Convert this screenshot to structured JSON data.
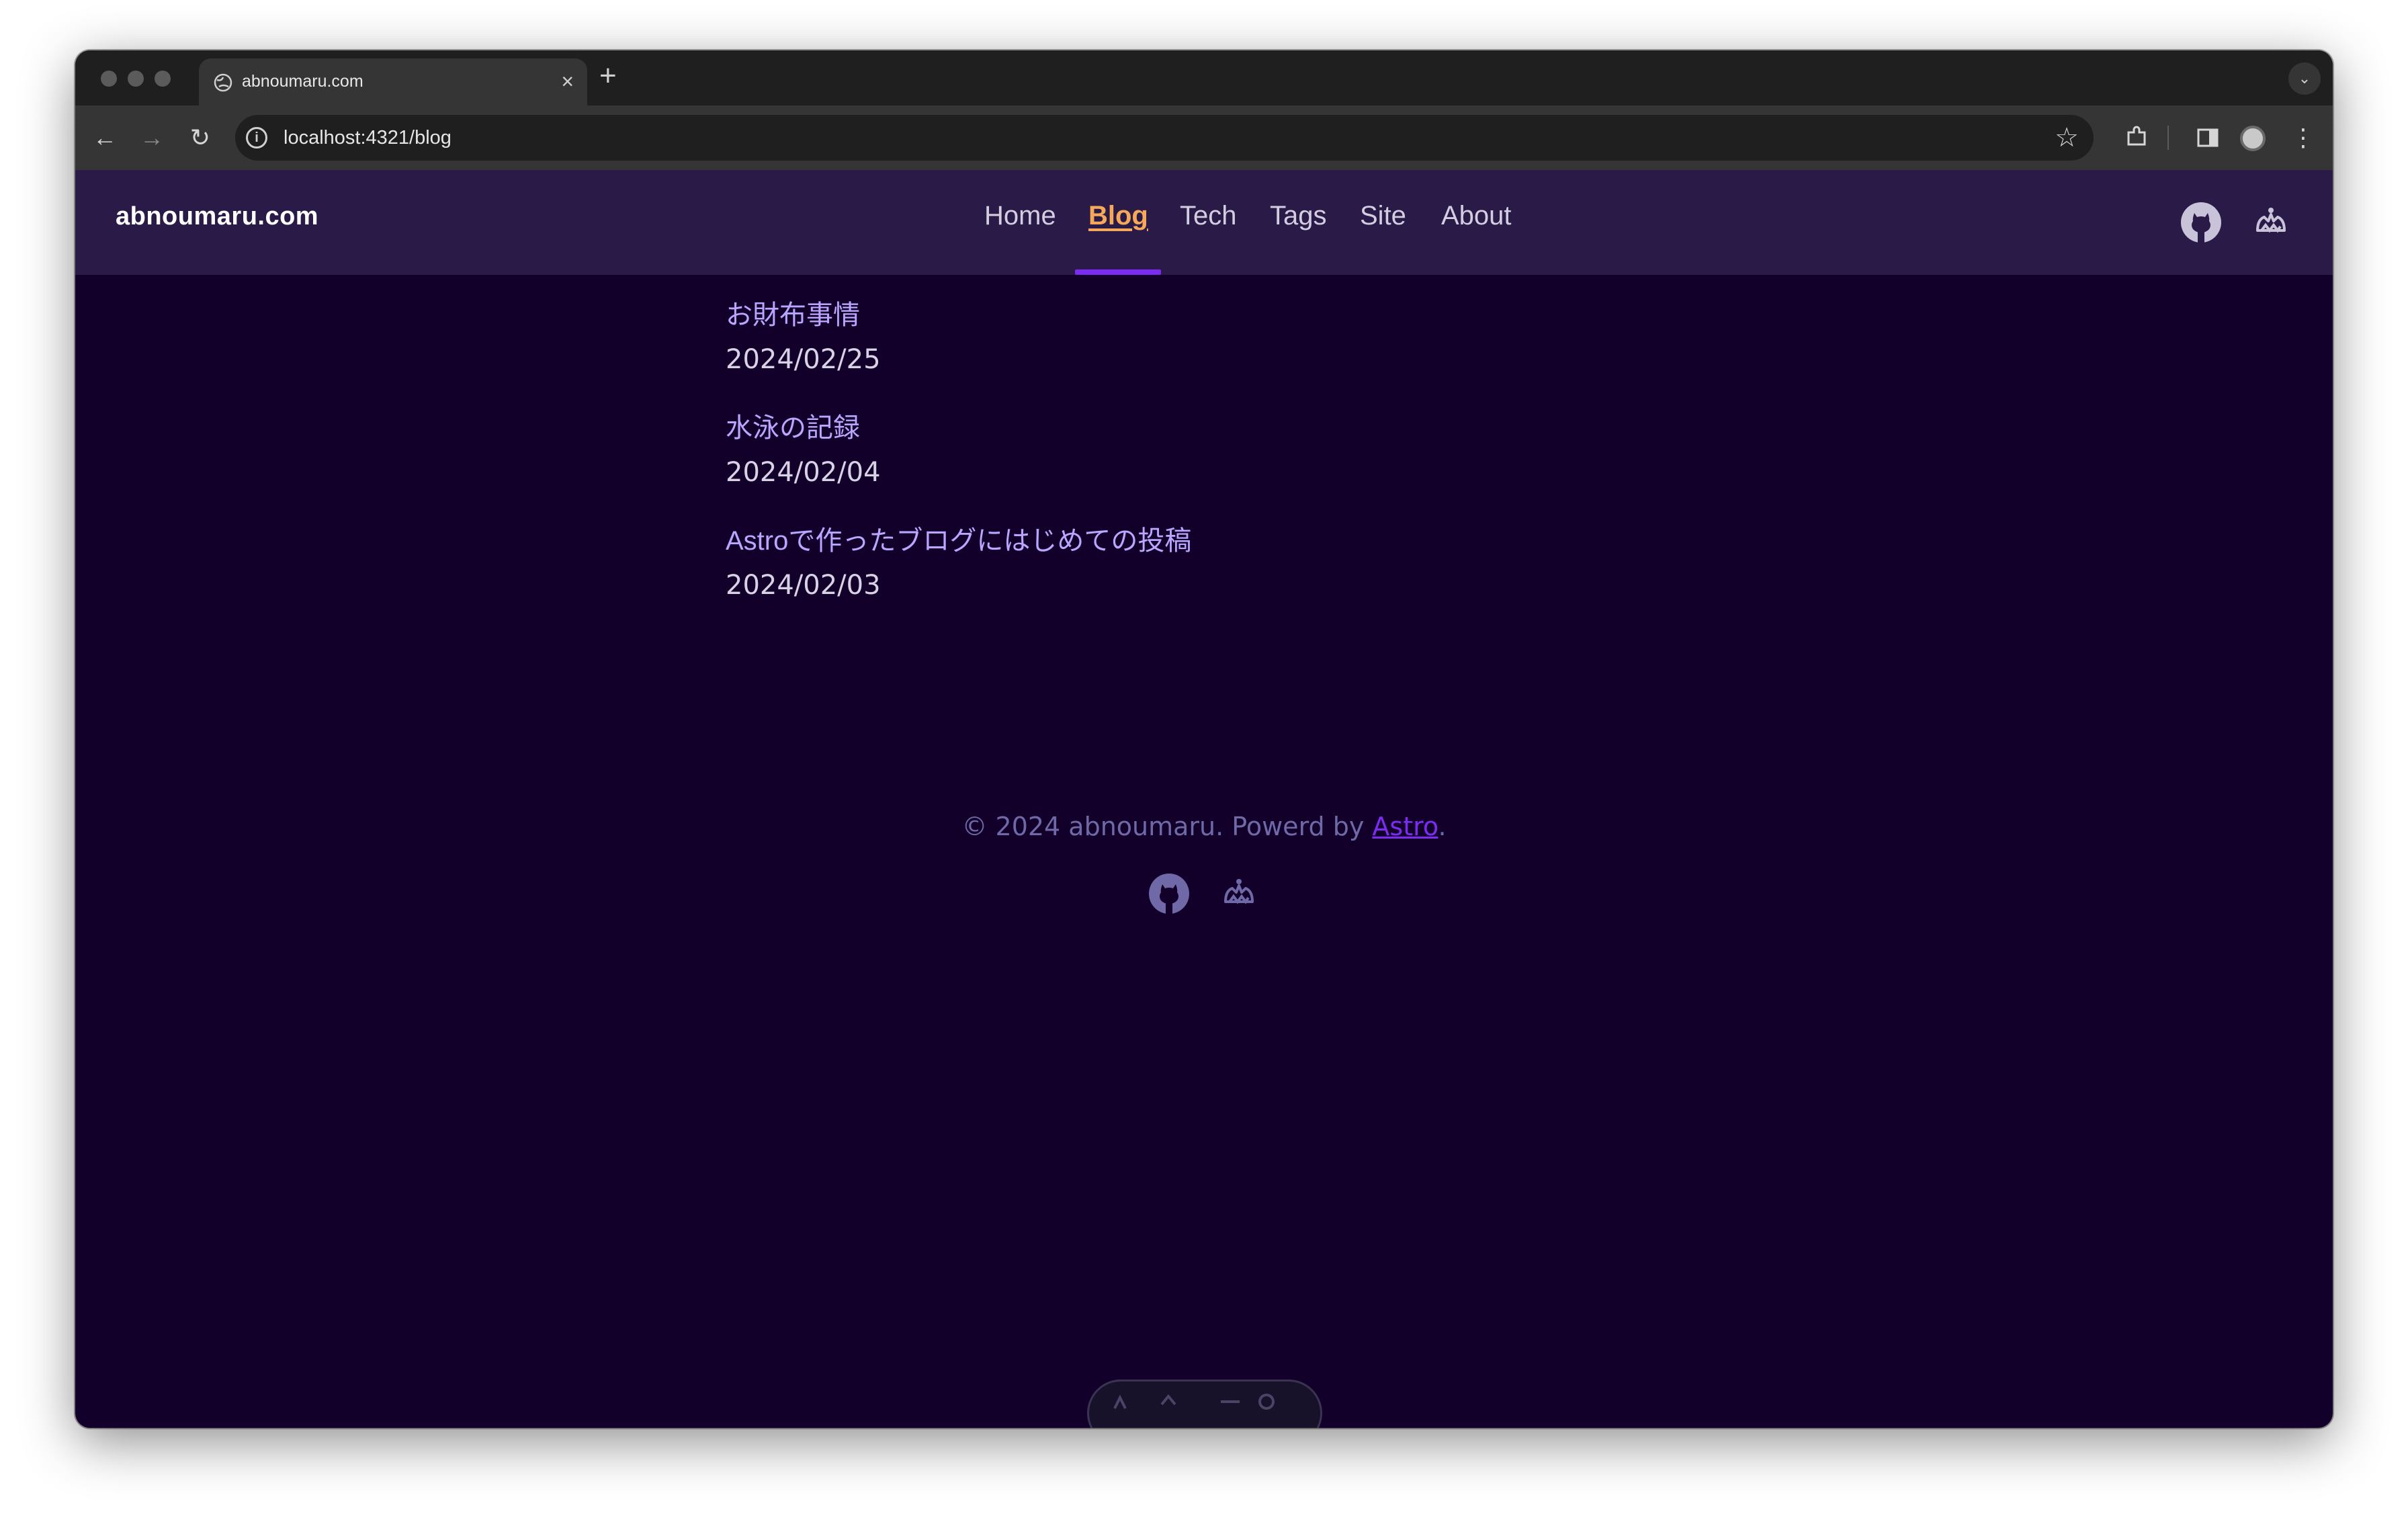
{
  "browser": {
    "tab_title": "abnoumaru.com",
    "tab_close": "×",
    "new_tab": "+",
    "url": "localhost:4321/blog"
  },
  "site": {
    "logo": "abnoumaru.com",
    "nav": [
      "Home",
      "Blog",
      "Tech",
      "Tags",
      "Site",
      "About"
    ],
    "active_nav": "Blog"
  },
  "posts": [
    {
      "title": "お財布事情",
      "date": "2024/02/25"
    },
    {
      "title": "水泳の記録",
      "date": "2024/02/04"
    },
    {
      "title": "Astroで作ったブログにはじめての投稿",
      "date": "2024/02/03"
    }
  ],
  "footer": {
    "prefix": "© 2024 abnoumaru. Powerd by ",
    "link": "Astro",
    "suffix": "."
  },
  "icons": {
    "header": [
      "github-icon",
      "misskey-icon"
    ],
    "footer": [
      "github-icon",
      "misskey-icon"
    ]
  },
  "colors": {
    "page_bg": "#13002a",
    "header_bg": "#2a1a48",
    "accent": "#7c2cf0",
    "active_nav": "#f6a85a",
    "post_title": "#b8a6ff"
  }
}
